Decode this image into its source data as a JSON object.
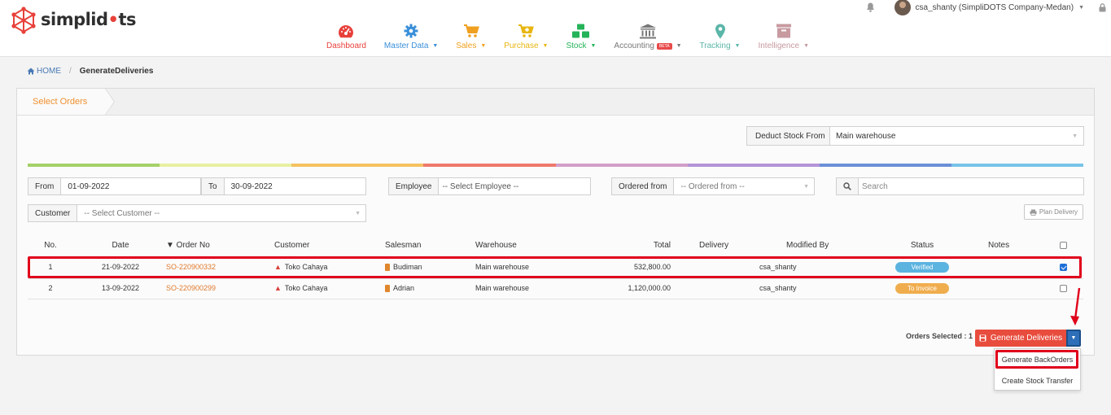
{
  "brand": {
    "name_part1": "simplid",
    "name_part2": "ts",
    "accent": "#e8413b"
  },
  "user": {
    "label": "csa_shanty (SimpliDOTS Company-Medan)"
  },
  "nav": {
    "dashboard": "Dashboard",
    "master_data": "Master Data",
    "sales": "Sales",
    "purchase": "Purchase",
    "stock": "Stock",
    "accounting": "Accounting",
    "accounting_badge": "BETA",
    "tracking": "Tracking",
    "intelligence": "Intelligence"
  },
  "breadcrumb": {
    "home": "HOME",
    "current": "GenerateDeliveries"
  },
  "panel": {
    "tab": "Select Orders",
    "deduct_label": "Deduct Stock From",
    "deduct_value": "Main warehouse"
  },
  "filters": {
    "from_label": "From",
    "from_value": "01-09-2022",
    "to_label": "To",
    "to_value": "30-09-2022",
    "employee_label": "Employee",
    "employee_placeholder": "-- Select Employee --",
    "ordered_from_label": "Ordered from",
    "ordered_from_placeholder": "-- Ordered from --",
    "search_placeholder": "Search",
    "customer_label": "Customer",
    "customer_placeholder": "-- Select Customer --",
    "plan_delivery": "Plan Delivery"
  },
  "table": {
    "headers": {
      "no": "No.",
      "date": "Date",
      "order_no": "▼ Order No",
      "customer": "Customer",
      "salesman": "Salesman",
      "warehouse": "Warehouse",
      "total": "Total",
      "delivery": "Delivery",
      "modified_by": "Modified By",
      "status": "Status",
      "notes": "Notes"
    },
    "rows": [
      {
        "no": "1",
        "date": "21-09-2022",
        "order_no": "SO-220900332",
        "customer": "Toko Cahaya",
        "salesman": "Budiman",
        "warehouse": "Main warehouse",
        "total": "532,800.00",
        "modified_by": "csa_shanty",
        "status": "Verified",
        "status_color": "#5bb3e0",
        "checked": true
      },
      {
        "no": "2",
        "date": "13-09-2022",
        "order_no": "SO-220900299",
        "customer": "Toko Cahaya",
        "salesman": "Adrian",
        "warehouse": "Main warehouse",
        "total": "1,120,000.00",
        "modified_by": "csa_shanty",
        "status": "To Invoice",
        "status_color": "#f0ad4e",
        "checked": false
      }
    ]
  },
  "actions": {
    "orders_selected": "Orders Selected : 1",
    "generate_deliveries": "Generate Deliveries",
    "menu": {
      "generate_backorders": "Generate BackOrders",
      "create_stock_transfer": "Create Stock Transfer"
    }
  },
  "colors": {
    "highlight": "#e0001b",
    "primary_btn": "#e84c3d",
    "dropdown_btn": "#2d6fb8",
    "link": "#e07a2e"
  }
}
